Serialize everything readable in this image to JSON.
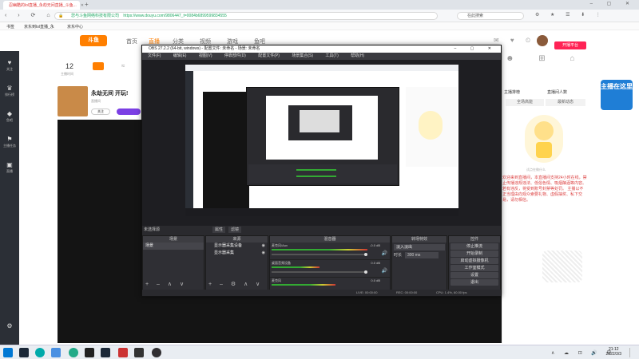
{
  "browser": {
    "tab_title": "忍幽酷的lol直播_永劫无间直播_斗鱼...",
    "url": "https://www.douyu.com/9806447_t=0084b6899599834555",
    "secure_label": "您与斗鱼网络科技有限公司",
    "search_placeholder": "在此搜索",
    "bookmarks": [
      "书签",
      "京东到lol直播_永",
      "京东中心"
    ]
  },
  "site": {
    "logo": "斗鱼",
    "nav": [
      "首页",
      "直播",
      "分类",
      "视频",
      "游戏",
      "鱼吧"
    ],
    "stats": {
      "count": "12",
      "count_label": "主播时间"
    },
    "streamer_title": "永劫无间 开玩!",
    "streamer_sub": "直播间",
    "follow_btn": "关注",
    "right_panel": {
      "btn": "开播平台",
      "tab1": "主播排榜",
      "tab2": "直播间人数",
      "chip1": "全场高能",
      "chip2": "最新动态",
      "chat": "欢迎来到直播间，本直播间支持24小时在线，禁止传播违规违法、低俗色情、吸烟酗酒等内容。若有违反，将受到账号封禁等处罚。 主播以不正当理由向观众索要礼物、虚假抽奖、私下交易，请勿相信。",
      "sticker": "主播在这里",
      "sticker_caption": "试点在做什么"
    }
  },
  "sidebar": {
    "items": [
      "关注",
      "排行榜",
      "鱼吧",
      "主播任务",
      "直播"
    ]
  },
  "obs": {
    "title": "OBS 27.2.2 (64-bit, windows) - 配置文件: 未命名 - 场景: 未命名",
    "menu": [
      "文件(F)",
      "编辑(E)",
      "视图(V)",
      "停靠部件(D)",
      "配置文件(P)",
      "场景集合(S)",
      "工具(T)",
      "帮助(H)"
    ],
    "no_source": "未选择源",
    "properties": "属性",
    "filters": "滤镜",
    "docks": {
      "scenes": {
        "title": "场景",
        "items": [
          "场景"
        ]
      },
      "sources": {
        "title": "来源",
        "items": [
          "显示器采集设备",
          "显示器采集"
        ]
      },
      "mixer": {
        "title": "混音器",
        "channels": [
          {
            "name": "麦克风/Aux",
            "db": "-0.0 dB"
          },
          {
            "name": "桌面音频设备",
            "db": "0.0 dB"
          },
          {
            "name": "麦克风",
            "db": "0.0 dB"
          }
        ]
      },
      "transitions": {
        "title": "转场特效",
        "type": "淡入淡出",
        "duration_label": "时长",
        "duration": "300 ms"
      },
      "controls": {
        "title": "控件",
        "buttons": [
          "停止推流",
          "开始录制",
          "启动虚拟摄像机",
          "工作室模式",
          "设置",
          "退出"
        ]
      }
    },
    "status": {
      "live": "LIVE: 00:00:00",
      "rec": "REC: 00:00:00",
      "cpu": "CPU: 1.4%, 60.00 fps"
    }
  },
  "taskbar": {
    "time": "21:12",
    "date": "2022/3/3"
  },
  "colors": {
    "brand": "#ff7f00",
    "obs_bg": "#2a2a2e",
    "accent_purple": "#7b3fe4"
  }
}
